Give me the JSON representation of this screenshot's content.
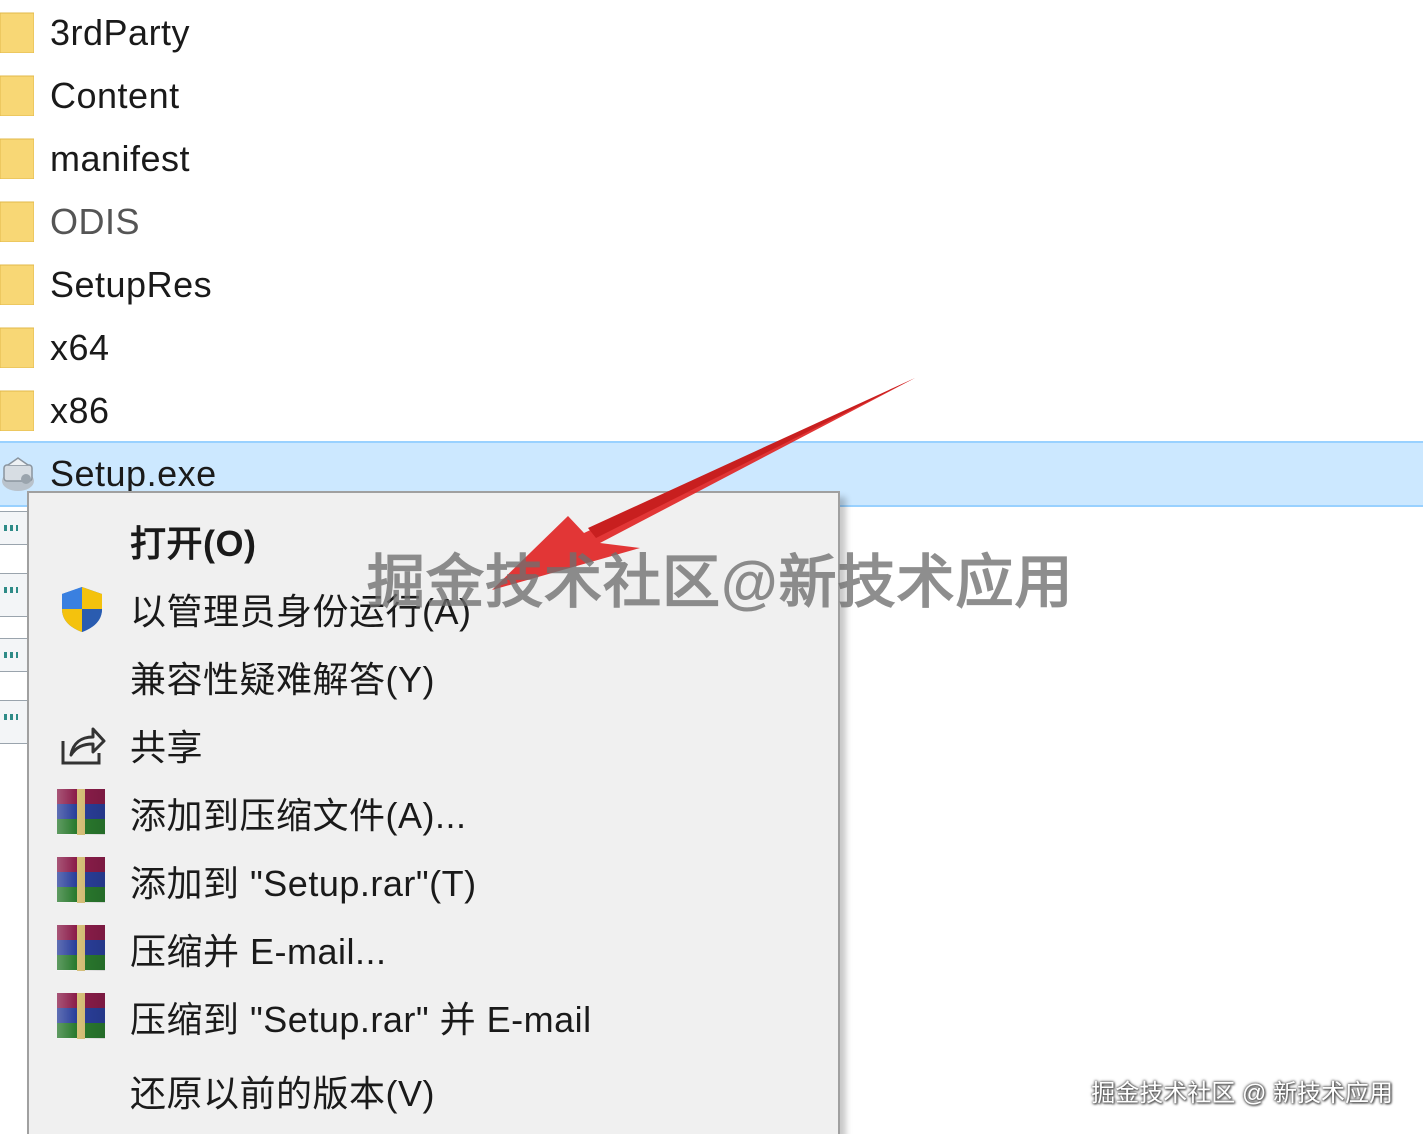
{
  "files": [
    {
      "name": "3rdParty",
      "type": "folder"
    },
    {
      "name": "Content",
      "type": "folder"
    },
    {
      "name": "manifest",
      "type": "folder"
    },
    {
      "name": "ODIS",
      "type": "folder"
    },
    {
      "name": "SetupRes",
      "type": "folder"
    },
    {
      "name": "x64",
      "type": "folder"
    },
    {
      "name": "x86",
      "type": "folder"
    },
    {
      "name": "Setup.exe",
      "type": "executable",
      "selected": true
    }
  ],
  "context_menu": {
    "items": [
      {
        "label": "打开(O)",
        "icon": "none",
        "default": true
      },
      {
        "label": "以管理员身份运行(A)",
        "icon": "uac-shield-icon"
      },
      {
        "label": "兼容性疑难解答(Y)",
        "icon": "none"
      },
      {
        "label": "共享",
        "icon": "share-icon"
      },
      {
        "label": "添加到压缩文件(A)...",
        "icon": "winrar-icon"
      },
      {
        "label": "添加到 \"Setup.rar\"(T)",
        "icon": "winrar-icon"
      },
      {
        "label": "压缩并 E-mail...",
        "icon": "winrar-icon"
      },
      {
        "label": "压缩到 \"Setup.rar\" 并 E-mail",
        "icon": "winrar-icon"
      },
      {
        "label": "还原以前的版本(V)",
        "icon": "none"
      }
    ]
  },
  "watermark": {
    "center_text": "掘金技术社区@新技术应用",
    "corner_text": "掘金技术社区 @ 新技术应用"
  },
  "colors": {
    "selection_bg": "#cce8ff",
    "selection_border": "#99d1ff",
    "menu_bg": "#f0f0f0",
    "folder_yellow": "#f8d775",
    "arrow_red": "#e02b2b"
  }
}
